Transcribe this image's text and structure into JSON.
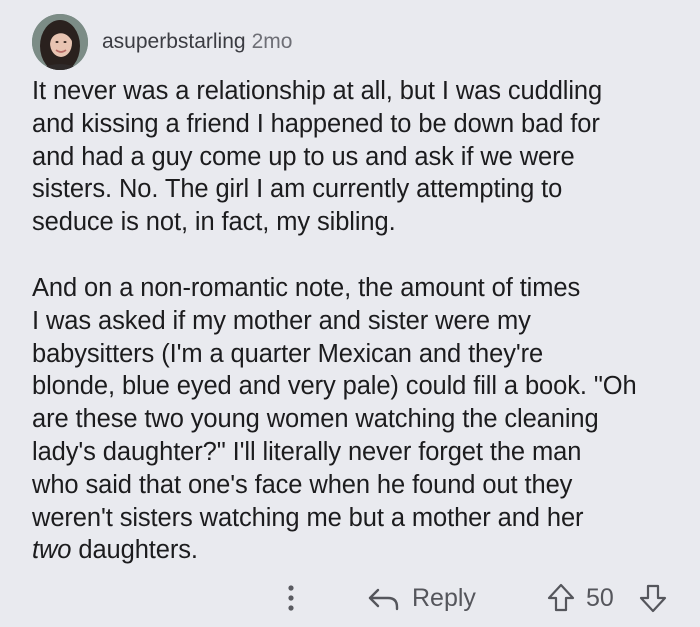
{
  "comment": {
    "author": "asuperbstarling",
    "age": "2mo",
    "avatar_icon": "user-avatar-photo",
    "paragraphs": [
      {
        "lines": [
          "It never was a relationship at all, but I was cuddling",
          "and kissing a friend I happened to be down bad for",
          "and had a guy come up to us and ask if we were",
          "sisters. No. The girl I am currently attempting to",
          "seduce is not, in fact, my sibling."
        ]
      },
      {
        "lines": [
          "And on a non-romantic note, the amount of times",
          "I was asked if my mother and sister were my",
          "babysitters (I'm a quarter Mexican and they're",
          "blonde, blue eyed and very pale) could fill a book. \"Oh",
          "are these two young women watching the cleaning",
          "lady's daughter?\" I'll literally never forget the man",
          "who said that one's face when he found out they",
          "weren't sisters watching me but a mother and her"
        ],
        "last_line_italic": "two",
        "last_line_rest": " daughters."
      }
    ]
  },
  "actions": {
    "more_icon": "more-vertical-icon",
    "reply_icon": "reply-arrow-icon",
    "reply_label": "Reply",
    "upvote_icon": "upvote-arrow-icon",
    "score": "50",
    "downvote_icon": "downvote-arrow-icon"
  },
  "colors": {
    "background": "#e9eaef",
    "text": "#1c1c1e",
    "muted": "#55565c"
  }
}
